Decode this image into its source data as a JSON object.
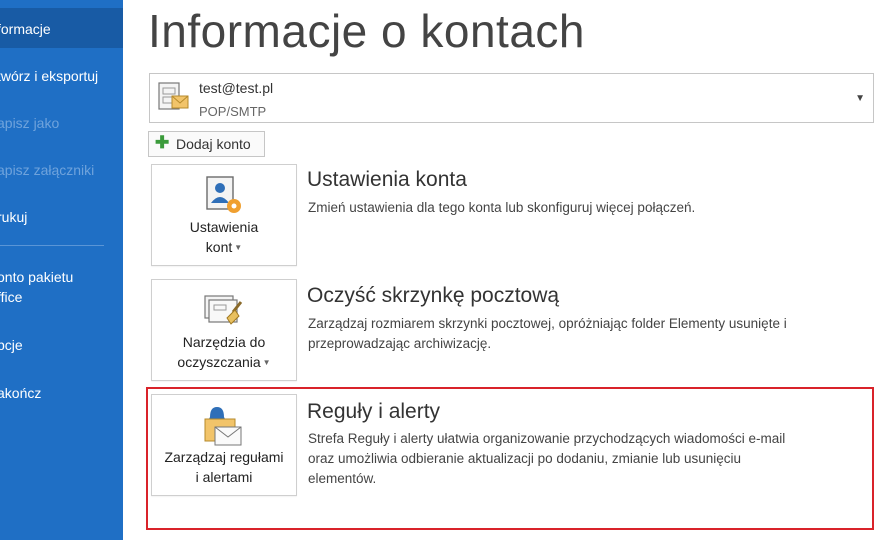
{
  "sidebar": {
    "items": [
      {
        "label": "formacje"
      },
      {
        "label": "twórz i eksportuj"
      },
      {
        "label": "apisz jako"
      },
      {
        "label": "apisz załączniki"
      },
      {
        "label": "rukuj"
      },
      {
        "label": "onto pakietu"
      },
      {
        "label": "ffice"
      },
      {
        "label": "pcje"
      },
      {
        "label": "akończ"
      }
    ]
  },
  "page": {
    "title": "Informacje o kontach"
  },
  "account": {
    "email": "test@test.pl",
    "type": "POP/SMTP"
  },
  "add_account_label": "Dodaj konto",
  "sections": {
    "settings": {
      "tile_line1": "Ustawienia",
      "tile_line2": "kont",
      "title": "Ustawienia konta",
      "desc": "Zmień ustawienia dla tego konta lub skonfiguruj więcej połączeń."
    },
    "cleanup": {
      "tile_line1": "Narzędzia do",
      "tile_line2": "oczyszczania",
      "title": "Oczyść skrzynkę pocztową",
      "desc_line1": "Zarządzaj rozmiarem skrzynki pocztowej, opróżniając folder Elementy usunięte i",
      "desc_line2": "przeprowadzając archiwizację."
    },
    "rules": {
      "tile_line1": "Zarządzaj regułami",
      "tile_line2": "i alertami",
      "title": "Reguły i alerty",
      "desc_line1": "Strefa Reguły i alerty ułatwia organizowanie przychodzących wiadomości e-mail",
      "desc_line2": "oraz umożliwia odbieranie aktualizacji po dodaniu, zmianie lub usunięciu",
      "desc_line3": "elementów."
    }
  },
  "colors": {
    "sidebar": "#1f6fc5",
    "sidebar_active": "#185ba5",
    "highlight": "#d9232a"
  },
  "icons": [
    "account-icon",
    "dropdown-caret-icon",
    "plus-icon",
    "account-settings-icon",
    "cleanup-tools-icon",
    "rules-alerts-icon"
  ]
}
